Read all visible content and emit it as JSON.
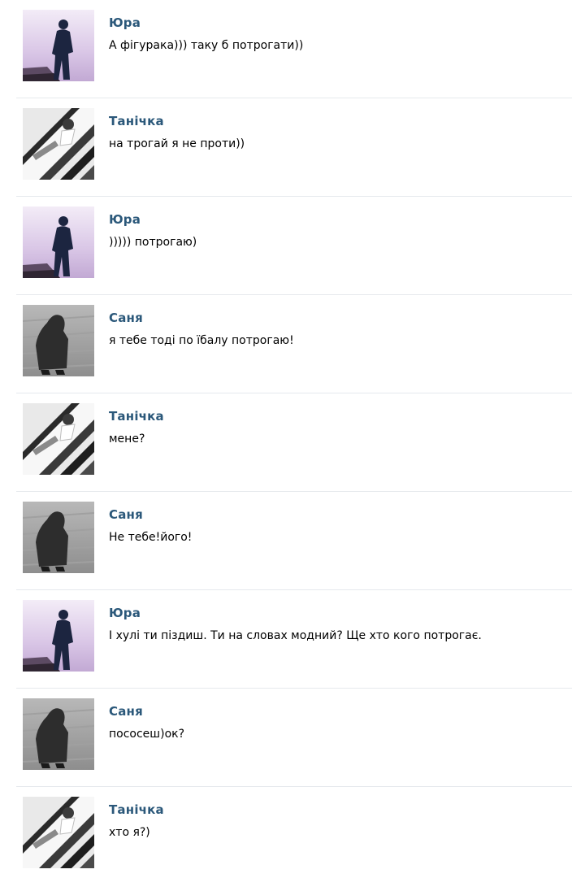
{
  "comments": [
    {
      "author": "Юра",
      "avatar": "silhouette-avatar",
      "text": "А фігурака))) таку б потрогати))"
    },
    {
      "author": "Танічка",
      "avatar": "stairs-avatar",
      "text": "на трогай я не проти))"
    },
    {
      "author": "Юра",
      "avatar": "silhouette-avatar",
      "text": "))))) потрогаю)"
    },
    {
      "author": "Саня",
      "avatar": "hooded-figure-avatar",
      "text": "я тебе тоді по їбалу потрогаю!"
    },
    {
      "author": "Танічка",
      "avatar": "stairs-avatar",
      "text": "мене?"
    },
    {
      "author": "Саня",
      "avatar": "hooded-figure-avatar",
      "text": "Не тебе!його!"
    },
    {
      "author": "Юра",
      "avatar": "silhouette-avatar",
      "text": "І хулі ти піздиш. Ти на словах модний? Ще хто кого потрогає."
    },
    {
      "author": "Саня",
      "avatar": "hooded-figure-avatar",
      "text": "пососеш)ок?"
    },
    {
      "author": "Танічка",
      "avatar": "stairs-avatar",
      "text": "хто я?)"
    }
  ],
  "colors": {
    "author_link": "#2b587a",
    "divider": "#e6e9ed",
    "text": "#000000"
  }
}
